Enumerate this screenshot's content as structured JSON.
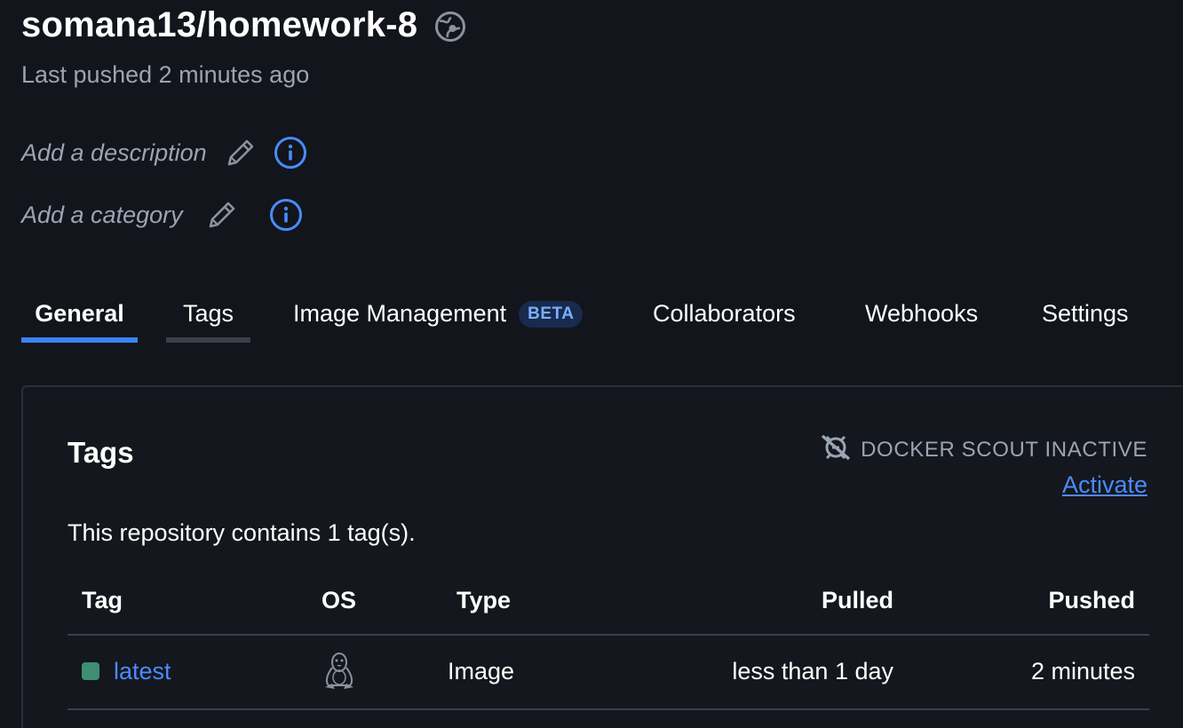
{
  "header": {
    "repo_name": "somana13/homework-8",
    "visibility_icon": "public-globe-icon",
    "last_pushed": "Last pushed 2 minutes ago"
  },
  "meta": {
    "description_placeholder": "Add a description",
    "category_placeholder": "Add a category",
    "edit_icon": "pencil-icon",
    "info_icon": "info-icon"
  },
  "tabs": [
    {
      "label": "General",
      "active": true
    },
    {
      "label": "Tags",
      "active": false
    },
    {
      "label": "Image Management",
      "badge": "BETA",
      "active": false
    },
    {
      "label": "Collaborators",
      "active": false
    },
    {
      "label": "Webhooks",
      "active": false
    },
    {
      "label": "Settings",
      "active": false
    }
  ],
  "tags_card": {
    "title": "Tags",
    "scout_status": "DOCKER SCOUT INACTIVE",
    "scout_icon": "scout-inactive-icon",
    "activate_label": "Activate",
    "summary": "This repository contains 1 tag(s).",
    "columns": [
      "Tag",
      "OS",
      "Type",
      "Pulled",
      "Pushed"
    ],
    "rows": [
      {
        "tag": "latest",
        "os_icon": "linux-tux-icon",
        "type": "Image",
        "pulled": "less than 1 day",
        "pushed": "2 minutes"
      }
    ]
  },
  "colors": {
    "background": "#12151b",
    "accent": "#3b82f6",
    "link": "#4a8bff",
    "muted_text": "#9aa4b3",
    "status_green": "#3e8f73"
  }
}
